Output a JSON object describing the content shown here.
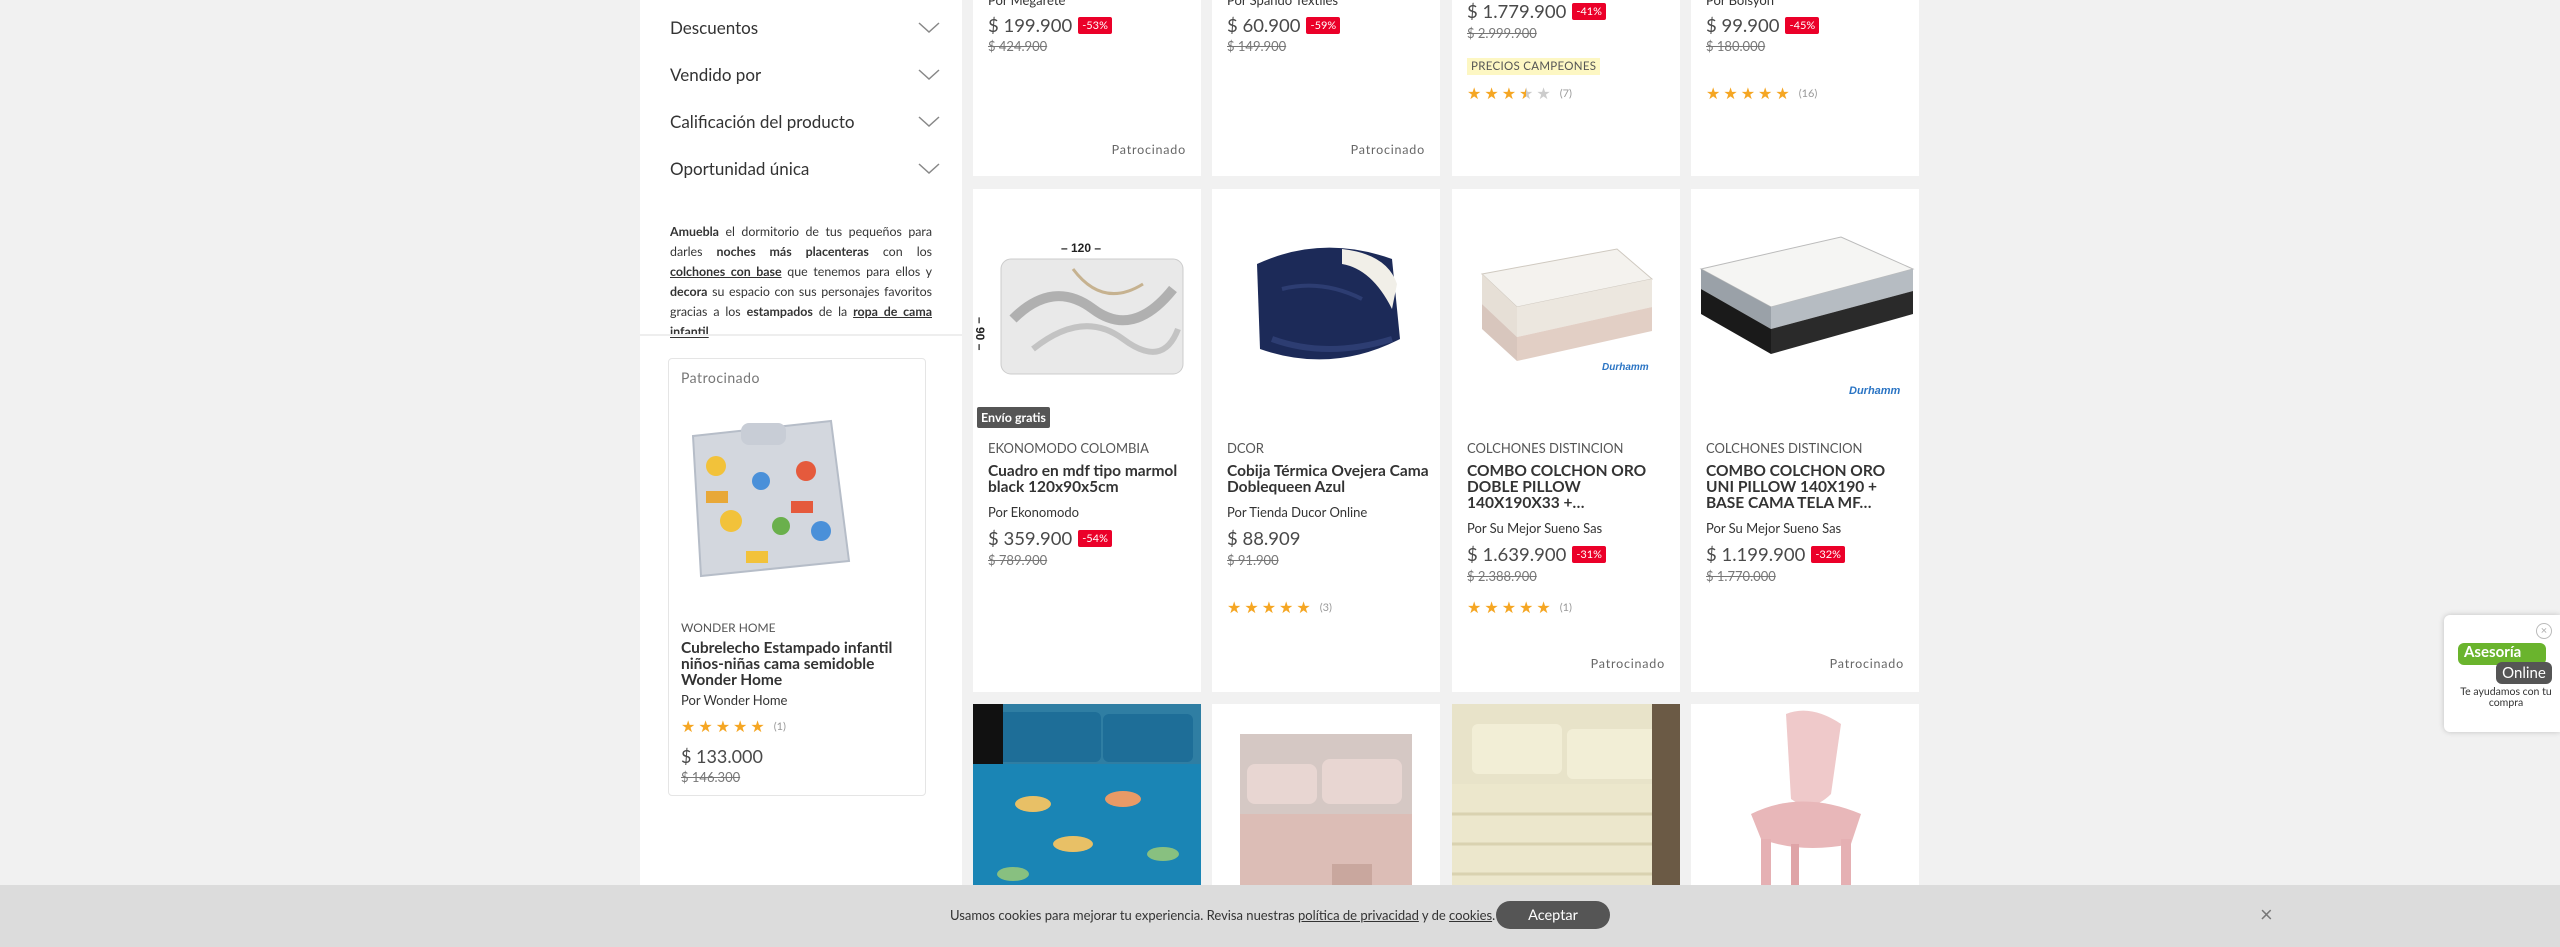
{
  "filters": [
    {
      "label": "Descuentos"
    },
    {
      "label": "Vendido por"
    },
    {
      "label": "Calificación del producto"
    },
    {
      "label": "Oportunidad única"
    }
  ],
  "description": {
    "p1": "Amuebla",
    "p2": " el dormitorio de tus pequeños para darles ",
    "p3": "noches más placenteras",
    "p4": " con los ",
    "p5": "colchones con base",
    "p6": " que tenemos para ellos y ",
    "p7": "decora",
    "p8": " su espacio con sus personajes favoritos gracias a los ",
    "p9": "estampados",
    "p10": " de la ",
    "p11": "ropa de cama infantil",
    "p12": "."
  },
  "sponsored_card": {
    "tag": "Patrocinado",
    "brand": "WONDER HOME",
    "title": "Cubrelecho Estampado infantil niños-niñas cama semidoble Wonder Home",
    "seller": "Por Wonder Home",
    "rating_count": "(1)",
    "price": "$ 133.000",
    "old_price": "$ 146.300"
  },
  "top_row": [
    {
      "seller": "Por Megarete",
      "price": "$ 199.900",
      "discount": "-53%",
      "old_price": "$ 424.900",
      "tag": "Patrocinado"
    },
    {
      "seller": "Por Spando Textiles",
      "price": "$ 60.900",
      "discount": "-59%",
      "old_price": "$ 149.900",
      "tag": "Patrocinado"
    },
    {
      "price": "$ 1.779.900",
      "discount": "-41%",
      "old_price": "$ 2.999.900",
      "badge": "PRECIOS CAMPEONES",
      "rating_count": "(7)"
    },
    {
      "seller": "Por Bolsyon",
      "price": "$ 99.900",
      "discount": "-45%",
      "old_price": "$ 180.000",
      "rating_count": "(16)"
    }
  ],
  "mid_row": [
    {
      "brand": "EKONOMODO COLOMBIA",
      "title": "Cuadro en mdf tipo marmol black 120x90x5cm",
      "seller": "Por Ekonomodo",
      "price": "$ 359.900",
      "discount": "-54%",
      "old_price": "$ 789.900",
      "envio": "Envío gratis",
      "img_top": "– 120 –",
      "img_side": "– 90 –"
    },
    {
      "brand": "DCOR",
      "title": "Cobija Térmica Ovejera Cama Doblequeen Azul",
      "seller": "Por Tienda Ducor Online",
      "price": "$ 88.909",
      "old_price": "$ 91.900",
      "rating_count": "(3)"
    },
    {
      "brand": "COLCHONES DISTINCION",
      "title": "COMBO COLCHON ORO DOBLE PILLOW 140X190X33 +…",
      "seller": "Por Su Mejor Sueno Sas",
      "price": "$ 1.639.900",
      "discount": "-31%",
      "old_price": "$ 2.388.900",
      "rating_count": "(1)",
      "tag": "Patrocinado"
    },
    {
      "brand": "COLCHONES DISTINCION",
      "title": "COMBO COLCHON ORO UNI PILLOW 140X190 + BASE CAMA TELA MF…",
      "seller": "Por Su Mejor Sueno Sas",
      "price": "$ 1.199.900",
      "discount": "-32%",
      "old_price": "$ 1.770.000",
      "tag": "Patrocinado"
    }
  ],
  "cookie": {
    "text1": "Usamos cookies para mejorar tu experiencia. Revisa nuestras ",
    "link1": "política de privacidad",
    "text2": " y de ",
    "link2": "cookies",
    "text3": ".",
    "accept": "Aceptar",
    "close": "×"
  },
  "chat": {
    "close": "×",
    "line1": "Asesoría",
    "line2": "Online",
    "sub": "Te ayudamos con tu compra"
  },
  "colors": {
    "discount": "#eb0029",
    "star": "#f5a623",
    "envio_bg": "#555555",
    "chat_green": "#6ab42d"
  }
}
